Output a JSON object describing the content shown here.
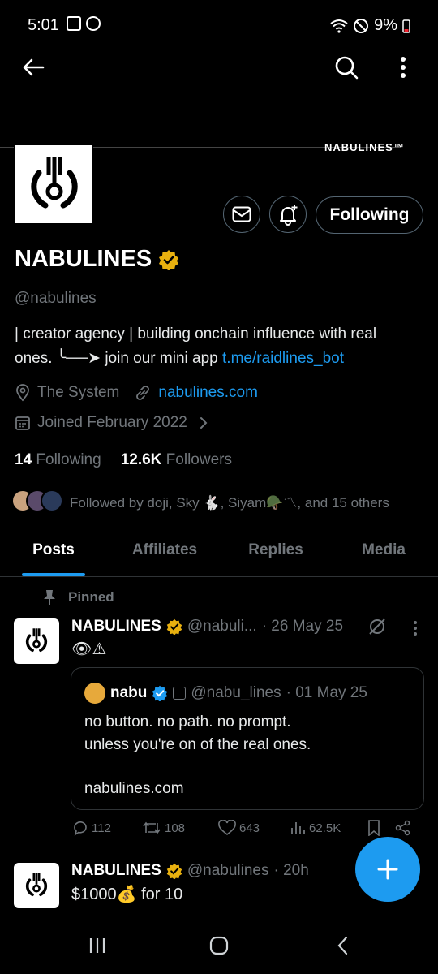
{
  "status_bar": {
    "time": "5:01",
    "battery": "9%"
  },
  "banner": {
    "text": "NABULINES™"
  },
  "profile": {
    "name": "NABULINES",
    "handle": "@nabulines",
    "bio_line1": "| creator agency | building onchain influence with real",
    "bio_line2_prefix": "ones. ╰──➤ join our mini app ",
    "bio_link": "t.me/raidlines_bot",
    "location": "The System",
    "website": "nabulines.com",
    "joined": "Joined February 2022",
    "following_count": "14",
    "following_label": "Following",
    "followers_count": "12.6K",
    "followers_label": "Followers",
    "followed_by": "Followed by doji, Sky 🐇, Siyam🪖〽, and 15 others",
    "follow_button": "Following"
  },
  "tabs": [
    "Posts",
    "Affiliates",
    "Replies",
    "Media"
  ],
  "pinned_label": "Pinned",
  "pinned_tweet": {
    "name": "NABULINES",
    "handle": "@nabuli...",
    "date": "· 26 May 25",
    "text": "👁⚠",
    "quote": {
      "name": "nabu",
      "handle": "@nabu_lines",
      "date": "· 01 May 25",
      "line1": "no button. no path. no prompt.",
      "line2": "unless you're on of the real ones.",
      "line3": "nabulines.com"
    },
    "stats": {
      "replies": "112",
      "reposts": "108",
      "likes": "643",
      "views": "62.5K"
    }
  },
  "second_tweet": {
    "name": "NABULINES",
    "handle": "@nabulines",
    "date": "· 20h",
    "text": "$1000💰 for 10"
  },
  "colors": {
    "accent": "#1d9bf0",
    "gold_badge": "#e8b00f",
    "muted": "#71767b"
  }
}
